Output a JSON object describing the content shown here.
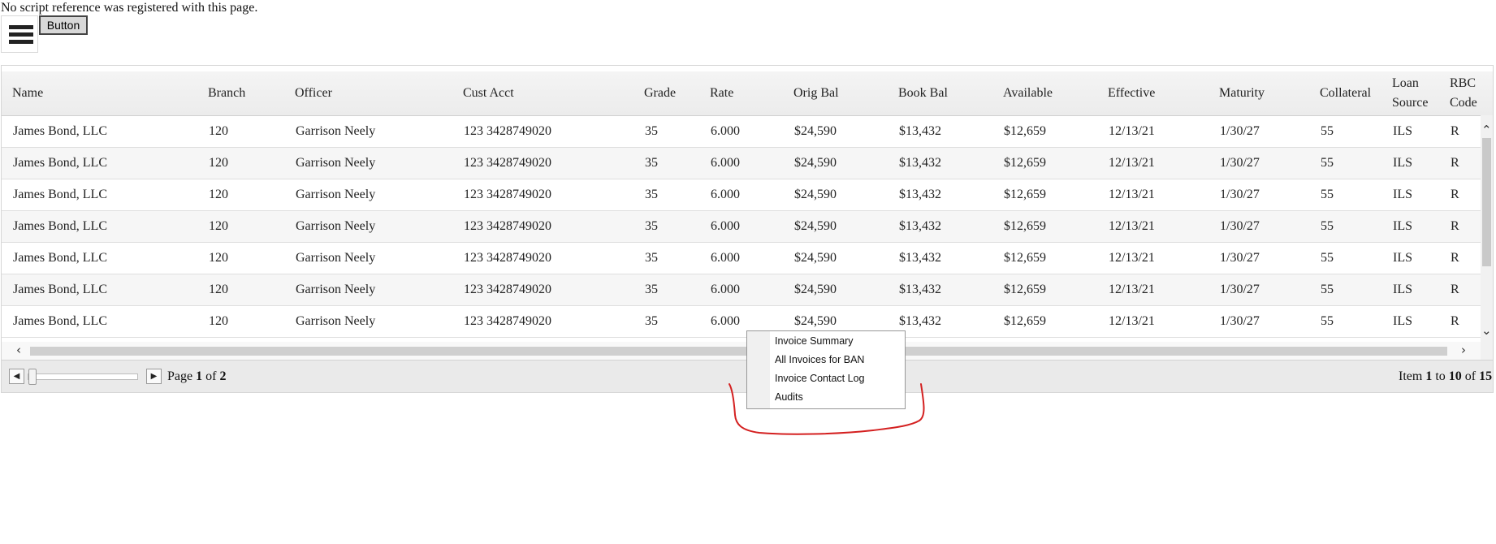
{
  "page": {
    "warning_text": "No script reference was registered with this page.",
    "button_label": "Button"
  },
  "grid": {
    "columns": [
      "Name",
      "Branch",
      "Officer",
      "Cust Acct",
      "Grade",
      "Rate",
      "Orig Bal",
      "Book Bal",
      "Available",
      "Effective",
      "Maturity",
      "Collateral",
      "Loan Source",
      "RBC Code"
    ],
    "rows": [
      [
        "James Bond, LLC",
        "120",
        "Garrison Neely",
        "123 3428749020",
        "35",
        "6.000",
        "$24,590",
        "$13,432",
        "$12,659",
        "12/13/21",
        "1/30/27",
        "55",
        "ILS",
        "R"
      ],
      [
        "James Bond, LLC",
        "120",
        "Garrison Neely",
        "123 3428749020",
        "35",
        "6.000",
        "$24,590",
        "$13,432",
        "$12,659",
        "12/13/21",
        "1/30/27",
        "55",
        "ILS",
        "R"
      ],
      [
        "James Bond, LLC",
        "120",
        "Garrison Neely",
        "123 3428749020",
        "35",
        "6.000",
        "$24,590",
        "$13,432",
        "$12,659",
        "12/13/21",
        "1/30/27",
        "55",
        "ILS",
        "R"
      ],
      [
        "James Bond, LLC",
        "120",
        "Garrison Neely",
        "123 3428749020",
        "35",
        "6.000",
        "$24,590",
        "$13,432",
        "$12,659",
        "12/13/21",
        "1/30/27",
        "55",
        "ILS",
        "R"
      ],
      [
        "James Bond, LLC",
        "120",
        "Garrison Neely",
        "123 3428749020",
        "35",
        "6.000",
        "$24,590",
        "$13,432",
        "$12,659",
        "12/13/21",
        "1/30/27",
        "55",
        "ILS",
        "R"
      ],
      [
        "James Bond, LLC",
        "120",
        "Garrison Neely",
        "123 3428749020",
        "35",
        "6.000",
        "$24,590",
        "$13,432",
        "$12,659",
        "12/13/21",
        "1/30/27",
        "55",
        "ILS",
        "R"
      ],
      [
        "James Bond, LLC",
        "120",
        "Garrison Neely",
        "123 3428749020",
        "35",
        "6.000",
        "$24,590",
        "$13,432",
        "$12,659",
        "12/13/21",
        "1/30/27",
        "55",
        "ILS",
        "R"
      ]
    ]
  },
  "pager": {
    "page_word": "Page",
    "current_page": "1",
    "of_word": "of",
    "total_pages": "2",
    "item_word": "Item",
    "range_start": "1",
    "to_word": "to",
    "range_end": "10",
    "total_items": "15"
  },
  "context_menu": {
    "items": [
      "Invoice Summary",
      "All Invoices for BAN",
      "Invoice Contact Log",
      "Audits"
    ]
  },
  "icons": {
    "menu": "hamburger-menu-icon",
    "prev": "triangle-left-icon",
    "next": "triangle-right-icon",
    "scroll_up": "chevron-up-icon",
    "scroll_down": "chevron-down-icon",
    "scroll_left": "chevron-left-icon",
    "scroll_right": "chevron-right-icon"
  },
  "colors": {
    "annotation": "#d42020",
    "header_bg": "#f0f0f0",
    "pager_bg": "#eaeaea"
  }
}
